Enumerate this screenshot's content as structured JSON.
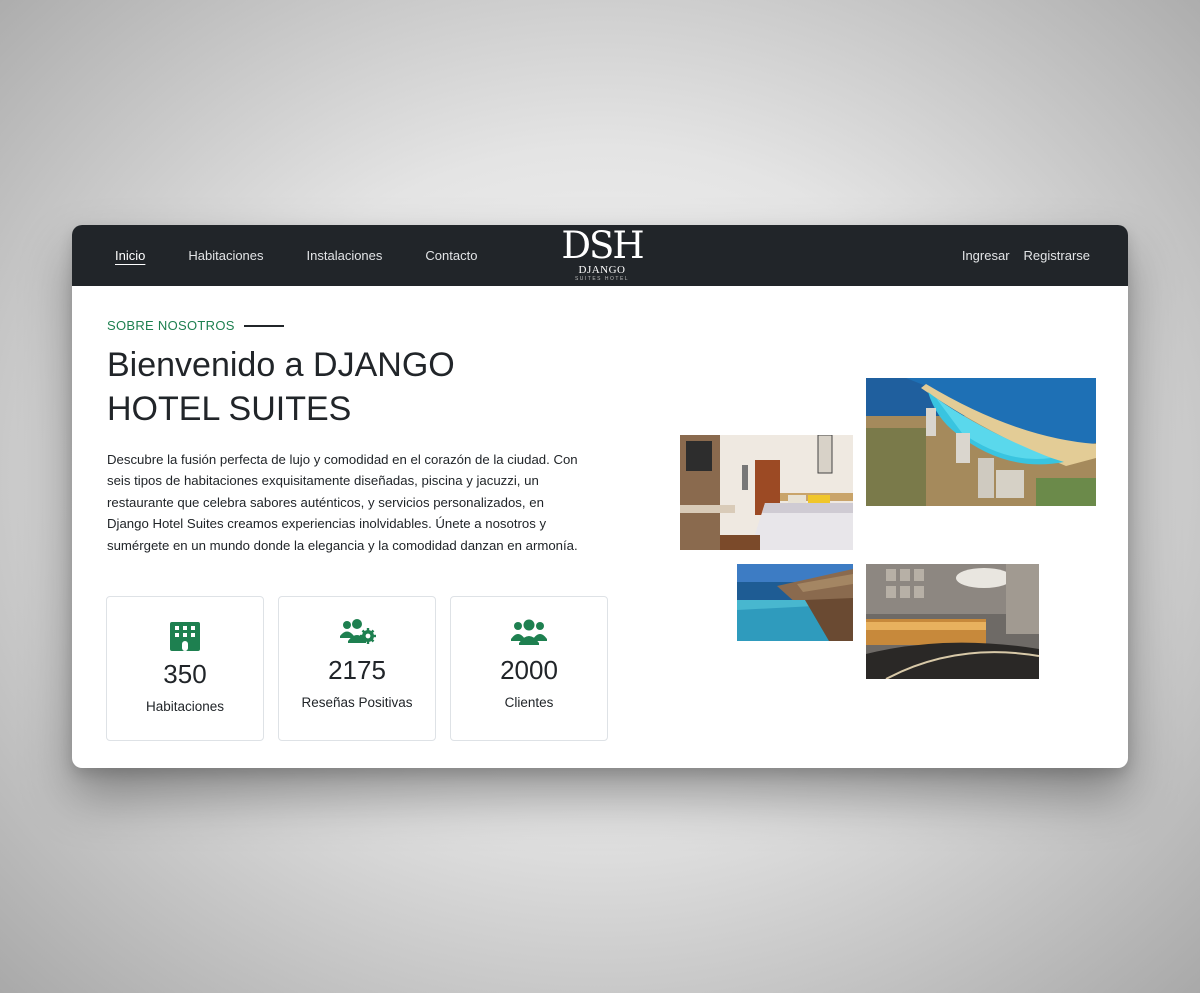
{
  "nav": {
    "links": [
      "Inicio",
      "Habitaciones",
      "Instalaciones",
      "Contacto"
    ],
    "login": "Ingresar",
    "register": "Registrarse"
  },
  "logo": {
    "mark": "DSH",
    "name": "DJANGO",
    "tagline": "SUITES HOTEL"
  },
  "about": {
    "eyebrow": "SOBRE NOSOTROS",
    "title": "Bienvenido a DJANGO HOTEL SUITES",
    "description": "Descubre la fusión perfecta de lujo y comodidad en el corazón de la ciudad. Con seis tipos de habitaciones exquisitamente diseñadas, piscina y jacuzzi, un restaurante que celebra sabores auténticos, y servicios personalizados, en Django Hotel Suites creamos experiencias inolvidables. Únete a nosotros y sumérgete en un mundo donde la elegancia y la comodidad danzan en armonía."
  },
  "stats": [
    {
      "icon": "hotel-icon",
      "value": "350",
      "label": "Habitaciones"
    },
    {
      "icon": "users-cog-icon",
      "value": "2175",
      "label": "Reseñas Positivas"
    },
    {
      "icon": "users-icon",
      "value": "2000",
      "label": "Clientes"
    }
  ],
  "colors": {
    "accent": "#1e8050",
    "navbar": "#212529",
    "text": "#212529"
  }
}
